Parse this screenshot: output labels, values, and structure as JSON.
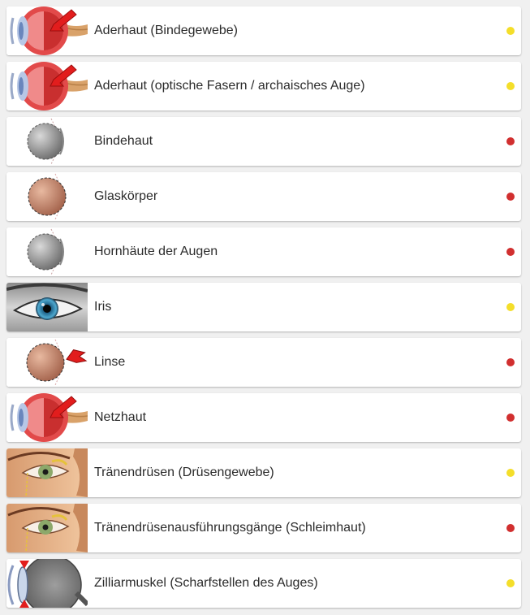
{
  "colors": {
    "yellow": "#f4de2a",
    "red": "#d12f2f"
  },
  "items": [
    {
      "label": "Aderhaut (Bindegewebe)",
      "status": "yellow",
      "icon": "eye-cross-section-arrow-icon"
    },
    {
      "label": "Aderhaut (optische Fasern / archaisches Auge)",
      "status": "yellow",
      "icon": "eye-cross-section-arrow-icon"
    },
    {
      "label": "Bindehaut",
      "status": "red",
      "icon": "gray-eyeball-icon"
    },
    {
      "label": "Glaskörper",
      "status": "red",
      "icon": "brown-eyeball-icon"
    },
    {
      "label": "Hornhäute der Augen",
      "status": "red",
      "icon": "gray-eyeball-icon"
    },
    {
      "label": "Iris",
      "status": "yellow",
      "icon": "iris-photo-icon"
    },
    {
      "label": "Linse",
      "status": "red",
      "icon": "brown-eyeball-arrow-icon"
    },
    {
      "label": "Netzhaut",
      "status": "red",
      "icon": "eye-cross-section-arrow-icon"
    },
    {
      "label": "Tränendrüsen (Drüsengewebe)",
      "status": "yellow",
      "icon": "tear-gland-icon"
    },
    {
      "label": "Tränendrüsenausführungsgänge (Schleimhaut)",
      "status": "red",
      "icon": "tear-gland-icon"
    },
    {
      "label": "Zilliarmuskel (Scharfstellen des Auges)",
      "status": "yellow",
      "icon": "ciliary-muscle-icon"
    }
  ]
}
